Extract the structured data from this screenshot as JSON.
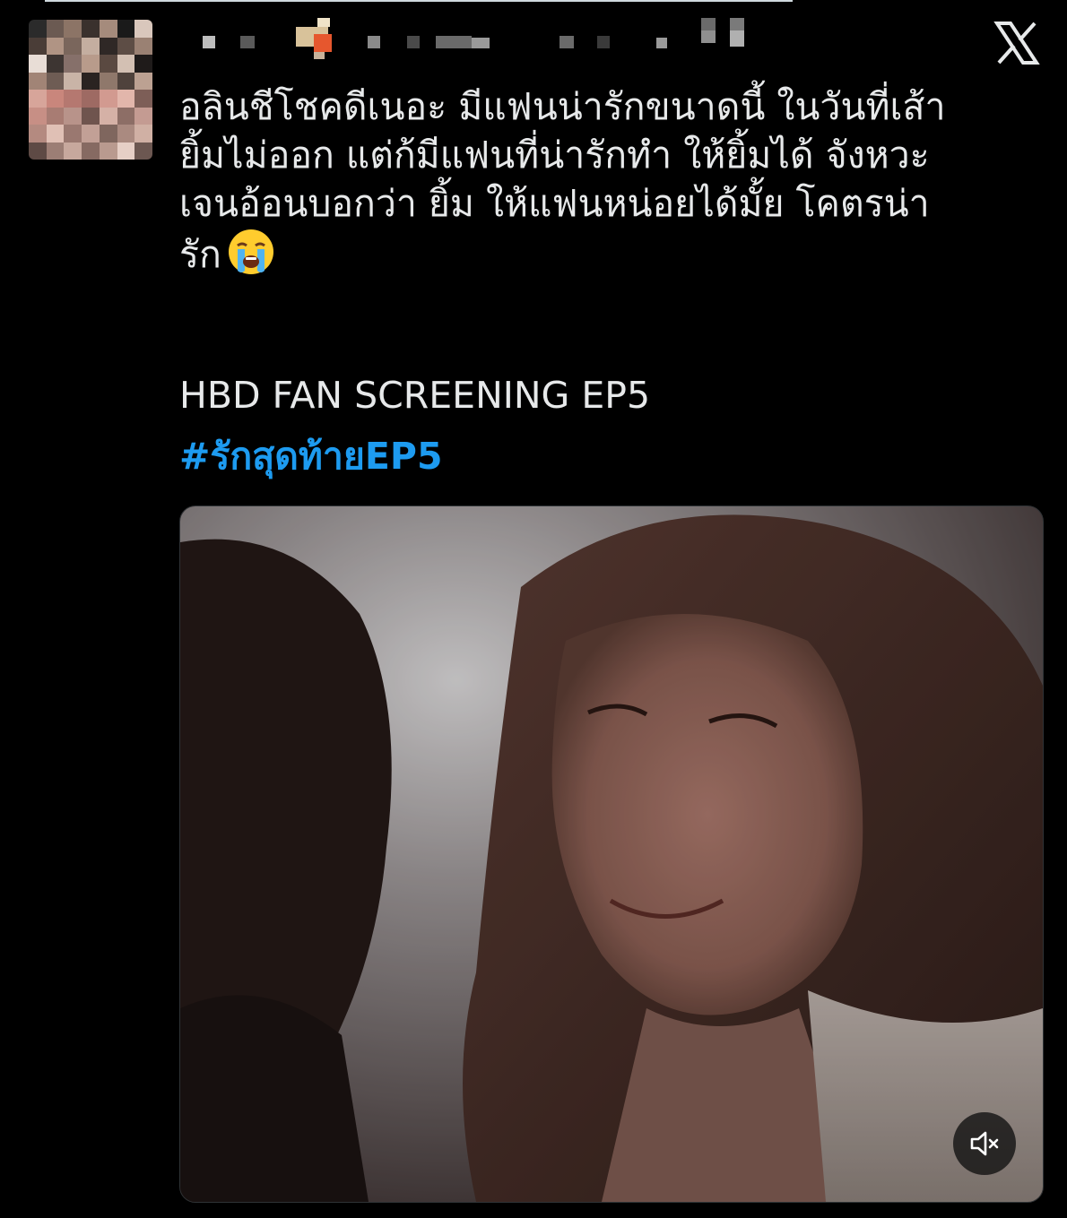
{
  "tweet": {
    "text_lines": [
      "อลินชีโชคดีเนอะ มีแฟนน่ารักขนาดนี้ ในวันที่เส้า",
      "ยิ้มไม่ออก แต่ก้มีแฟนที่น่ารักทำ ให้ยิ้มได้ จังหวะ",
      "เจนอ้อนบอกว่า ยิ้ม ให้แฟนหน่อยได้มั้ย โคตรน่า",
      "รัก"
    ],
    "emoji": "loudly-crying-face",
    "headline": "HBD FAN SCREENING EP5",
    "hashtag": "#รักสุดท้ายEP5"
  },
  "icons": {
    "brand": "x-logo-icon",
    "mute": "speaker-muted-icon"
  },
  "colors": {
    "background": "#000000",
    "text": "#e7e9ea",
    "hashtag": "#1d9bf0"
  }
}
